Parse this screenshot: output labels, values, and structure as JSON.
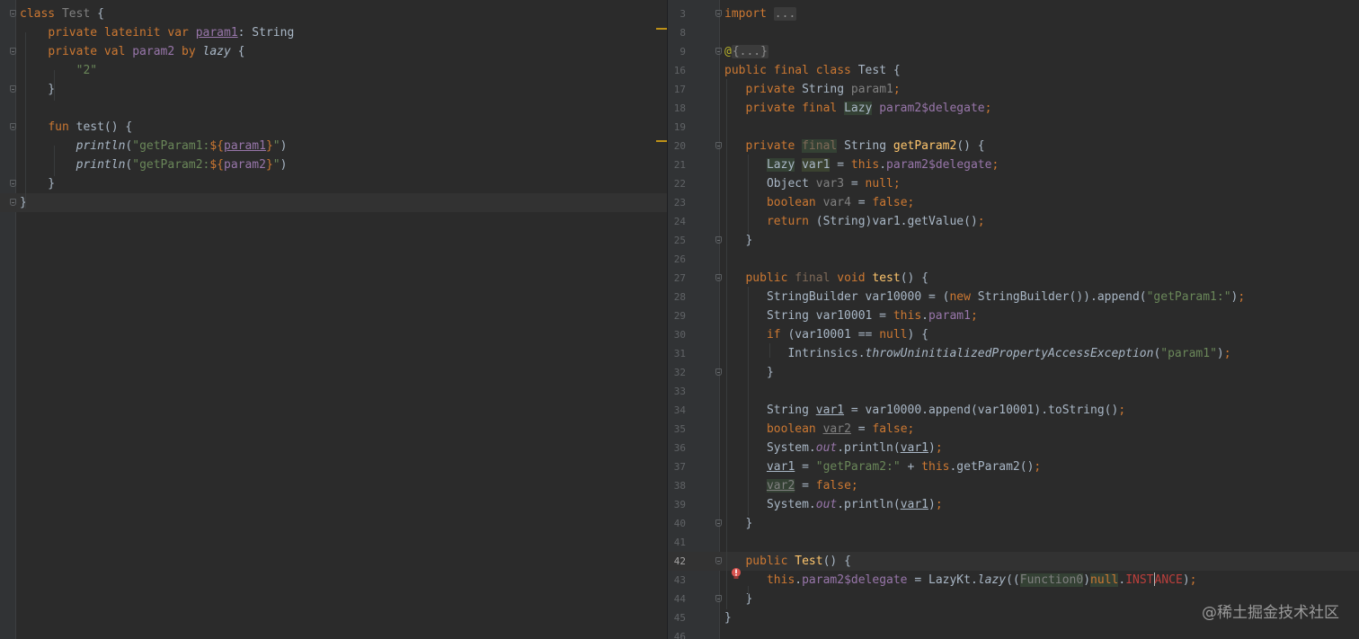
{
  "left_editor": {
    "language": "Kotlin",
    "lines": [
      {
        "parts": [
          [
            "kw",
            "class "
          ],
          [
            "gray",
            "Test "
          ],
          [
            "",
            "{"
          ]
        ]
      },
      {
        "parts": [
          [
            "",
            "    "
          ],
          [
            "kw",
            "private lateinit var "
          ],
          [
            "field ul",
            "param1"
          ],
          [
            "",
            ": String"
          ]
        ]
      },
      {
        "parts": [
          [
            "",
            "    "
          ],
          [
            "kw",
            "private val "
          ],
          [
            "field",
            "param2 "
          ],
          [
            "kw",
            "by "
          ],
          [
            "it",
            "lazy"
          ],
          [
            "",
            " {"
          ]
        ]
      },
      {
        "parts": [
          [
            "",
            "        "
          ],
          [
            "str",
            "\"2\""
          ]
        ]
      },
      {
        "parts": [
          [
            "",
            "    }"
          ]
        ]
      },
      {
        "parts": [
          [
            "",
            ""
          ]
        ]
      },
      {
        "parts": [
          [
            "",
            "    "
          ],
          [
            "kw",
            "fun "
          ],
          [
            "",
            "test() {"
          ]
        ]
      },
      {
        "parts": [
          [
            "",
            "        "
          ],
          [
            "it",
            "println"
          ],
          [
            "",
            "("
          ],
          [
            "str",
            "\"getParam1:"
          ],
          [
            "kw",
            "${"
          ],
          [
            "field ul",
            "param1"
          ],
          [
            "kw",
            "}"
          ],
          [
            "str",
            "\""
          ],
          [
            "",
            ")"
          ]
        ]
      },
      {
        "parts": [
          [
            "",
            "        "
          ],
          [
            "it",
            "println"
          ],
          [
            "",
            "("
          ],
          [
            "str",
            "\"getParam2:"
          ],
          [
            "kw",
            "${"
          ],
          [
            "field",
            "param2"
          ],
          [
            "kw",
            "}"
          ],
          [
            "str",
            "\""
          ],
          [
            "",
            ")"
          ]
        ]
      },
      {
        "parts": [
          [
            "",
            "    }"
          ]
        ]
      },
      {
        "parts": [
          [
            "",
            "}"
          ]
        ]
      }
    ]
  },
  "right_editor": {
    "language": "Java (decompiled)",
    "lines": [
      {
        "num": "3",
        "parts": [
          [
            "kw",
            "import "
          ],
          [
            "fold-box",
            "..."
          ]
        ]
      },
      {
        "num": "8",
        "parts": [
          [
            "",
            ""
          ]
        ]
      },
      {
        "num": "9",
        "parts": [
          [
            "ann",
            "@"
          ],
          [
            "fold-box",
            "{...}"
          ]
        ]
      },
      {
        "num": "16",
        "parts": [
          [
            "kw",
            "public final class "
          ],
          [
            "",
            "Test {"
          ]
        ]
      },
      {
        "num": "17",
        "parts": [
          [
            "",
            "   "
          ],
          [
            "kw",
            "private "
          ],
          [
            "",
            "String "
          ],
          [
            "gray",
            "param1"
          ],
          [
            "kw",
            ";"
          ]
        ]
      },
      {
        "num": "18",
        "parts": [
          [
            "",
            "   "
          ],
          [
            "kw",
            "private final "
          ],
          [
            "hl",
            "Lazy"
          ],
          [
            "",
            " "
          ],
          [
            "field",
            "param2$delegate"
          ],
          [
            "kw",
            ";"
          ]
        ]
      },
      {
        "num": "19",
        "parts": [
          [
            "",
            ""
          ]
        ]
      },
      {
        "num": "20",
        "parts": [
          [
            "",
            "   "
          ],
          [
            "kw",
            "private "
          ],
          [
            "fadedkw hl",
            "final"
          ],
          [
            "",
            " String "
          ],
          [
            "fn",
            "getParam2"
          ],
          [
            "",
            "() {"
          ]
        ]
      },
      {
        "num": "21",
        "parts": [
          [
            "",
            "      "
          ],
          [
            "hl",
            "Lazy"
          ],
          [
            "",
            " "
          ],
          [
            "hl2",
            "var1"
          ],
          [
            "",
            " = "
          ],
          [
            "kw",
            "this"
          ],
          [
            "",
            "."
          ],
          [
            "field",
            "param2$delegate"
          ],
          [
            "kw",
            ";"
          ]
        ]
      },
      {
        "num": "22",
        "parts": [
          [
            "",
            "      Object "
          ],
          [
            "gray",
            "var3"
          ],
          [
            "",
            " = "
          ],
          [
            "kw",
            "null;"
          ]
        ]
      },
      {
        "num": "23",
        "parts": [
          [
            "",
            "      "
          ],
          [
            "kw",
            "boolean "
          ],
          [
            "gray",
            "var4"
          ],
          [
            "",
            " = "
          ],
          [
            "kw",
            "false;"
          ]
        ]
      },
      {
        "num": "24",
        "parts": [
          [
            "",
            "      "
          ],
          [
            "kw",
            "return "
          ],
          [
            "",
            "(String)var1.getValue()"
          ],
          [
            "kw",
            ";"
          ]
        ]
      },
      {
        "num": "25",
        "parts": [
          [
            "",
            "   }"
          ]
        ]
      },
      {
        "num": "26",
        "parts": [
          [
            "",
            ""
          ]
        ]
      },
      {
        "num": "27",
        "parts": [
          [
            "",
            "   "
          ],
          [
            "kw",
            "public "
          ],
          [
            "fadedkw",
            "final "
          ],
          [
            "kw",
            "void "
          ],
          [
            "fn",
            "test"
          ],
          [
            "",
            "() {"
          ]
        ]
      },
      {
        "num": "28",
        "parts": [
          [
            "",
            "      StringBuilder var10000 = ("
          ],
          [
            "kw",
            "new "
          ],
          [
            "",
            "StringBuilder()).append("
          ],
          [
            "str",
            "\"getParam1:\""
          ],
          [
            "",
            ")"
          ],
          [
            "kw",
            ";"
          ]
        ]
      },
      {
        "num": "29",
        "parts": [
          [
            "",
            "      String var10001 = "
          ],
          [
            "kw",
            "this"
          ],
          [
            "",
            "."
          ],
          [
            "field",
            "param1"
          ],
          [
            "kw",
            ";"
          ]
        ]
      },
      {
        "num": "30",
        "parts": [
          [
            "",
            "      "
          ],
          [
            "kw",
            "if "
          ],
          [
            "",
            "(var10001 == "
          ],
          [
            "kw",
            "null"
          ],
          [
            "",
            ") {"
          ]
        ]
      },
      {
        "num": "31",
        "parts": [
          [
            "",
            "         Intrinsics."
          ],
          [
            "it",
            "throwUninitializedPropertyAccessException"
          ],
          [
            "",
            "("
          ],
          [
            "str",
            "\"param1\""
          ],
          [
            "",
            ")"
          ],
          [
            "kw",
            ";"
          ]
        ]
      },
      {
        "num": "32",
        "parts": [
          [
            "",
            "      }"
          ]
        ]
      },
      {
        "num": "33",
        "parts": [
          [
            "",
            ""
          ]
        ]
      },
      {
        "num": "34",
        "parts": [
          [
            "",
            "      String "
          ],
          [
            "ul",
            "var1"
          ],
          [
            "",
            " = var10000.append(var10001).toString()"
          ],
          [
            "kw",
            ";"
          ]
        ]
      },
      {
        "num": "35",
        "parts": [
          [
            "",
            "      "
          ],
          [
            "kw",
            "boolean "
          ],
          [
            "gray ul",
            "var2"
          ],
          [
            "",
            " = "
          ],
          [
            "kw",
            "false;"
          ]
        ]
      },
      {
        "num": "36",
        "parts": [
          [
            "",
            "      System."
          ],
          [
            "stat",
            "out"
          ],
          [
            "",
            ".println("
          ],
          [
            "ul",
            "var1"
          ],
          [
            "",
            ")"
          ],
          [
            "kw",
            ";"
          ]
        ]
      },
      {
        "num": "37",
        "parts": [
          [
            "",
            "      "
          ],
          [
            "ul",
            "var1"
          ],
          [
            "",
            " = "
          ],
          [
            "str",
            "\"getParam2:\""
          ],
          [
            "",
            " + "
          ],
          [
            "kw",
            "this"
          ],
          [
            "",
            ".getParam2()"
          ],
          [
            "kw",
            ";"
          ]
        ]
      },
      {
        "num": "38",
        "parts": [
          [
            "",
            "      "
          ],
          [
            "gray ul hl",
            "var2"
          ],
          [
            "",
            " = "
          ],
          [
            "kw",
            "false;"
          ]
        ]
      },
      {
        "num": "39",
        "parts": [
          [
            "",
            "      System."
          ],
          [
            "stat",
            "out"
          ],
          [
            "",
            ".println("
          ],
          [
            "ul",
            "var1"
          ],
          [
            "",
            ")"
          ],
          [
            "kw",
            ";"
          ]
        ]
      },
      {
        "num": "40",
        "parts": [
          [
            "",
            "   }"
          ]
        ]
      },
      {
        "num": "41",
        "parts": [
          [
            "",
            ""
          ]
        ]
      },
      {
        "num": "42",
        "parts": [
          [
            "",
            "   "
          ],
          [
            "kw",
            "public "
          ],
          [
            "fn",
            "Test"
          ],
          [
            "",
            "() {"
          ]
        ]
      },
      {
        "num": "43",
        "parts": [
          [
            "",
            "      "
          ],
          [
            "kw",
            "this"
          ],
          [
            "",
            "."
          ],
          [
            "field",
            "param2$delegate"
          ],
          [
            "",
            " = LazyKt."
          ],
          [
            "it",
            "lazy"
          ],
          [
            "",
            "(("
          ],
          [
            "hl gray",
            "Function0"
          ],
          [
            "",
            ")"
          ],
          [
            "kw hl",
            "null"
          ],
          [
            "",
            "."
          ],
          [
            "err",
            "INST"
          ],
          [
            "caret",
            ""
          ],
          [
            "err",
            "ANCE"
          ],
          [
            "",
            ")"
          ],
          [
            "kw",
            ";"
          ]
        ]
      },
      {
        "num": "44",
        "parts": [
          [
            "",
            "   }"
          ]
        ]
      },
      {
        "num": "45",
        "parts": [
          [
            "",
            "}"
          ]
        ]
      },
      {
        "num": "46",
        "parts": [
          [
            "",
            ""
          ]
        ]
      }
    ]
  },
  "icons": {
    "error_bulb": "red-bulb-icon"
  },
  "colors": {
    "background": "#2b2b2b",
    "keyword": "#cc7832",
    "string": "#6a8759",
    "field": "#9876aa",
    "method": "#ffc66d",
    "marker": "#be9117"
  },
  "watermark": "@稀土掘金技术社区"
}
